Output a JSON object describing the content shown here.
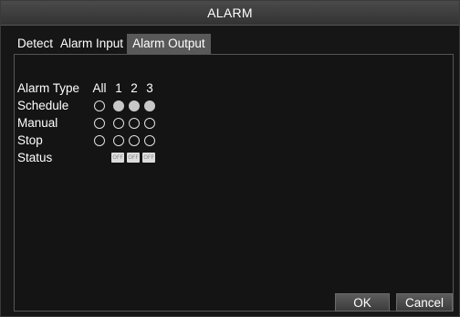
{
  "window": {
    "title": "ALARM"
  },
  "tabs": [
    {
      "label": "Detect",
      "active": false
    },
    {
      "label": "Alarm Input",
      "active": false
    },
    {
      "label": "Alarm Output",
      "active": true
    }
  ],
  "grid": {
    "header": {
      "label": "Alarm Type",
      "columns": [
        "All",
        "1",
        "2",
        "3"
      ]
    },
    "rows": [
      {
        "label": "Schedule",
        "all_checked": false,
        "channels_checked": [
          true,
          true,
          true
        ]
      },
      {
        "label": "Manual",
        "all_checked": false,
        "channels_checked": [
          false,
          false,
          false
        ]
      },
      {
        "label": "Stop",
        "all_checked": false,
        "channels_checked": [
          false,
          false,
          false
        ]
      }
    ],
    "status": {
      "label": "Status",
      "values": [
        "OFF",
        "OFF",
        "OFF"
      ]
    }
  },
  "buttons": {
    "ok": "OK",
    "cancel": "Cancel"
  }
}
